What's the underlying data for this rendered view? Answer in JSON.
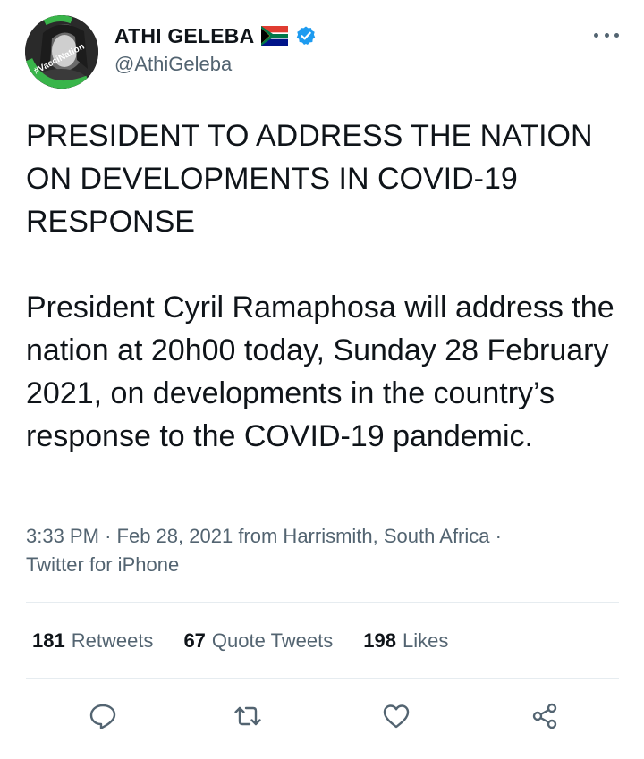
{
  "tweet": {
    "author": {
      "display_name": "ATHI GELEBA",
      "handle": "@AthiGeleba",
      "avatar_badge_text": "#VacciNation",
      "verified": true,
      "flag": "south-africa-flag"
    },
    "headline": "PRESIDENT TO ADDRESS THE NATION ON DEVELOPMENTS IN COVID-19 RESPONSE",
    "body": "President Cyril Ramaphosa will address the nation at 20h00 today, Sunday 28 February 2021, on developments in the country’s response to the COVID-19 pandemic.",
    "meta": {
      "time": "3:33 PM",
      "date": "Feb 28, 2021",
      "location": "from Harrismith, South Africa",
      "source": "Twitter for iPhone",
      "separator": "·"
    },
    "stats": {
      "retweets": {
        "count": "181",
        "label": "Retweets"
      },
      "quote_tweets": {
        "count": "67",
        "label": "Quote Tweets"
      },
      "likes": {
        "count": "198",
        "label": "Likes"
      }
    }
  },
  "icons": [
    "more-icon",
    "reply-icon",
    "retweet-icon",
    "like-icon",
    "share-icon",
    "verified-icon"
  ],
  "colors": {
    "text_primary": "#0f1419",
    "text_secondary": "#536471",
    "verified_blue": "#1d9bf0",
    "icon_gray": "#536471",
    "divider": "#e6ecf0"
  }
}
